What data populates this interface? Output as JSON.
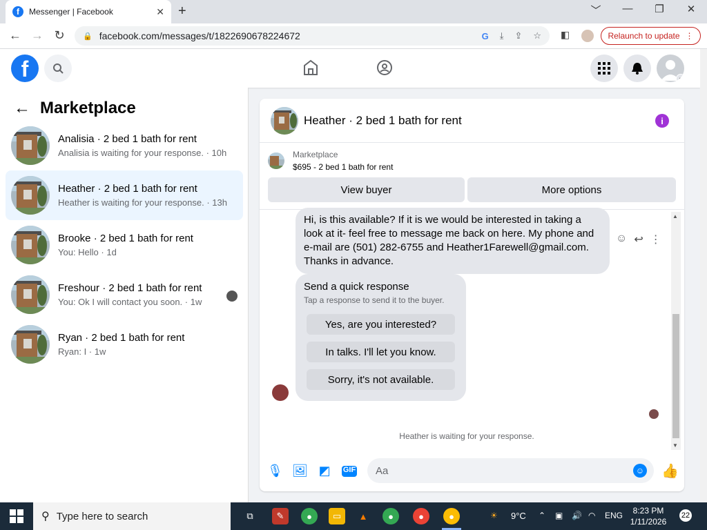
{
  "browser": {
    "tab_title": "Messenger | Facebook",
    "tab_close": "✕",
    "new_tab": "+",
    "url": "facebook.com/messages/t/1822690678224672",
    "relaunch_label": "Relaunch to update",
    "minimize": "﹀",
    "restore": "—",
    "maximize": "❐",
    "close": "✕"
  },
  "header": {
    "logo_letter": "f"
  },
  "sidebar": {
    "title": "Marketplace",
    "back": "←",
    "conversations": [
      {
        "name": "Analisia · 2 bed 1 bath for rent",
        "preview": "Analisia is waiting for your response. · 10h"
      },
      {
        "name": "Heather · 2 bed 1 bath for rent",
        "preview": "Heather is waiting for your response. · 13h"
      },
      {
        "name": "Brooke · 2 bed 1 bath for rent",
        "preview": "You: Hello · 1d"
      },
      {
        "name": "Freshour · 2 bed 1 bath for rent",
        "preview": "You: Ok I will contact you soon. · 1w"
      },
      {
        "name": "Ryan · 2 bed 1 bath for rent",
        "preview": "Ryan: I · 1w"
      }
    ]
  },
  "chat": {
    "title": "Heather · 2 bed 1 bath for rent",
    "info": "i",
    "listing_label": "Marketplace",
    "listing_price": "$695 - 2 bed 1 bath for rent",
    "view_buyer": "View buyer",
    "more_options": "More options",
    "message": "Hi, is this available?  If it is we would be interested in taking a look at it- feel free to message me back on here.  My phone and e-mail are (501) 282-6755 and Heather1Farewell@gmail.com.  Thanks in advance.",
    "quick_title": "Send a quick response",
    "quick_sub": "Tap a response to send it to the buyer.",
    "quick_options": [
      "Yes, are you interested?",
      "In talks. I'll let you know.",
      "Sorry, it's not available."
    ],
    "waiting": "Heather is waiting for your response.",
    "input_placeholder": "Aa"
  },
  "taskbar": {
    "search_placeholder": "Type here to search",
    "weather": "9°C",
    "language": "ENG",
    "time": "8:23 PM",
    "date": "1/11/2026",
    "notifications": "22"
  },
  "colors": {
    "facebook_blue": "#1877f2",
    "messenger_blue": "#0084ff",
    "active_row": "#ebf5ff",
    "relaunch_red": "#c5221f",
    "info_purple": "#a033d6"
  }
}
